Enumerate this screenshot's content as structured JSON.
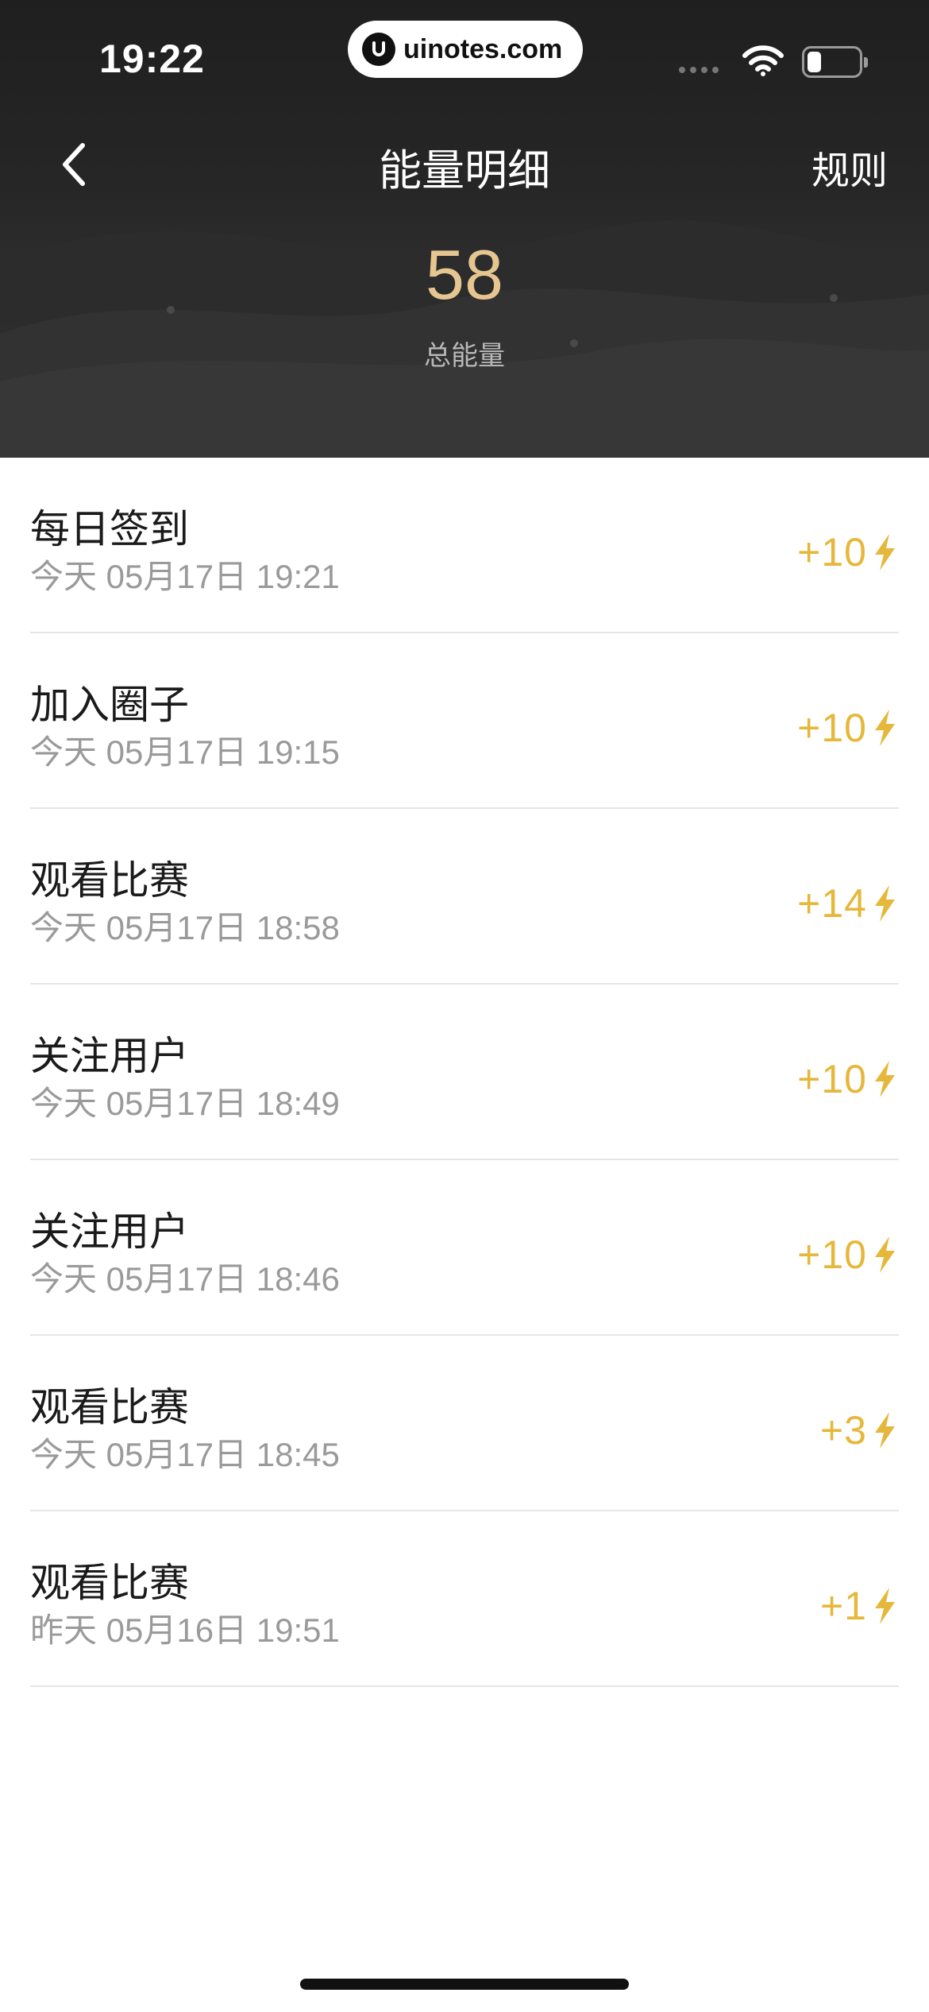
{
  "status_bar": {
    "time": "19:22",
    "url": "uinotes.com"
  },
  "nav": {
    "title": "能量明细",
    "rule_label": "规则"
  },
  "summary": {
    "total_value": "58",
    "total_label": "总能量"
  },
  "colors": {
    "header_bg": "#222222",
    "accent_gold": "#e5b73a",
    "total_value": "#e6c690"
  },
  "records": [
    {
      "title": "每日签到",
      "time": "今天 05月17日 19:21",
      "points": "+10"
    },
    {
      "title": "加入圈子",
      "time": "今天 05月17日 19:15",
      "points": "+10"
    },
    {
      "title": "观看比赛",
      "time": "今天 05月17日 18:58",
      "points": "+14"
    },
    {
      "title": "关注用户",
      "time": "今天 05月17日 18:49",
      "points": "+10"
    },
    {
      "title": "关注用户",
      "time": "今天 05月17日 18:46",
      "points": "+10"
    },
    {
      "title": "观看比赛",
      "time": "今天 05月17日 18:45",
      "points": "+3"
    },
    {
      "title": "观看比赛",
      "time": "昨天 05月16日 19:51",
      "points": "+1"
    }
  ]
}
